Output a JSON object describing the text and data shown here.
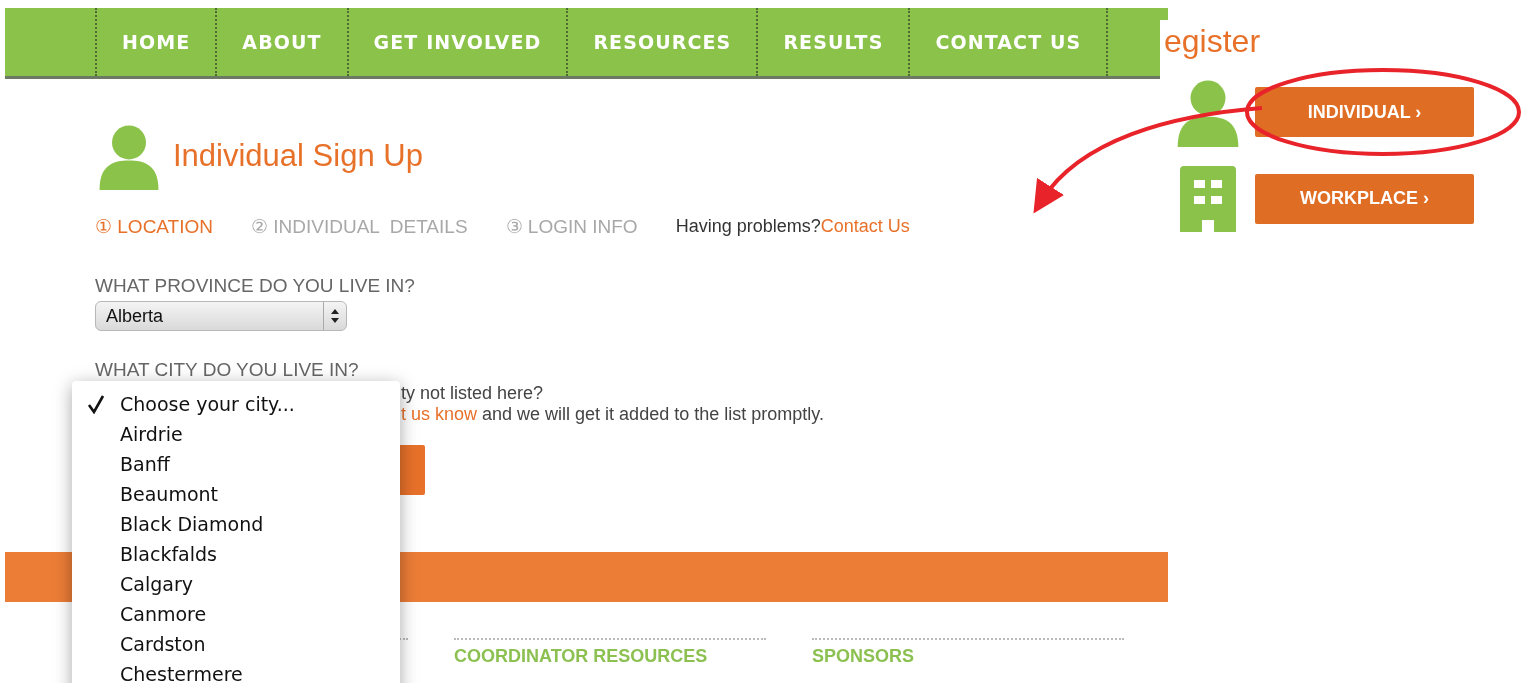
{
  "nav": [
    "HOME",
    "ABOUT",
    "GET INVOLVED",
    "RESOURCES",
    "RESULTS",
    "CONTACT US"
  ],
  "heading": "Individual Sign Up",
  "steps": [
    {
      "number": "①",
      "label": "LOCATION",
      "selected": true
    },
    {
      "number": "②",
      "label": "INDIVIDUAL  DETAILS",
      "selected": false
    },
    {
      "number": "③",
      "label": "LOGIN INFO",
      "selected": false
    }
  ],
  "help": {
    "text": "Having problems?",
    "link": "Contact Us"
  },
  "province": {
    "label": "WHAT PROVINCE DO YOU LIVE IN?",
    "value": "Alberta"
  },
  "city": {
    "label": "WHAT CITY DO YOU LIVE IN?",
    "note": "ty not listed here?",
    "note_link": "t us know",
    "note_rest": " and we will get it added to the list promptly."
  },
  "city_menu": [
    {
      "label": "Choose your city...",
      "selected": true
    },
    {
      "label": "Airdrie",
      "selected": false
    },
    {
      "label": "Banff",
      "selected": false
    },
    {
      "label": "Beaumont",
      "selected": false
    },
    {
      "label": "Black Diamond",
      "selected": false
    },
    {
      "label": "Blackfalds",
      "selected": false
    },
    {
      "label": "Calgary",
      "selected": false
    },
    {
      "label": "Canmore",
      "selected": false
    },
    {
      "label": "Cardston",
      "selected": false
    },
    {
      "label": "Chestermere",
      "selected": false
    }
  ],
  "footer_columns": [
    "COORDINATOR RESOURCES",
    "SPONSORS"
  ],
  "register": {
    "title": "egister",
    "buttons": [
      {
        "kind": "person",
        "label": "INDIVIDUAL ›"
      },
      {
        "kind": "building",
        "label": "WORKPLACE ›"
      }
    ]
  }
}
